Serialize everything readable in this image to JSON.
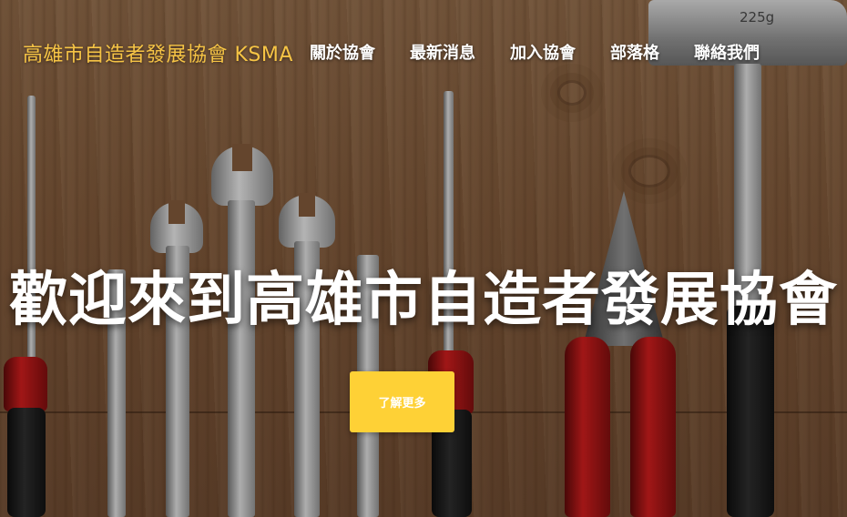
{
  "navbar": {
    "brand": "高雄市自造者發展協會 KSMA",
    "links": [
      {
        "label": "關於協會"
      },
      {
        "label": "最新消息"
      },
      {
        "label": "加入協會"
      },
      {
        "label": "部落格"
      },
      {
        "label": "聯絡我們"
      }
    ]
  },
  "hero": {
    "title": "歡迎來到高雄市自造者發展協會",
    "cta_label": "了解更多",
    "hammer_label": "225g"
  },
  "colors": {
    "brand": "#f6c445",
    "cta_background": "#fed136",
    "nav_text": "#ffffff"
  }
}
